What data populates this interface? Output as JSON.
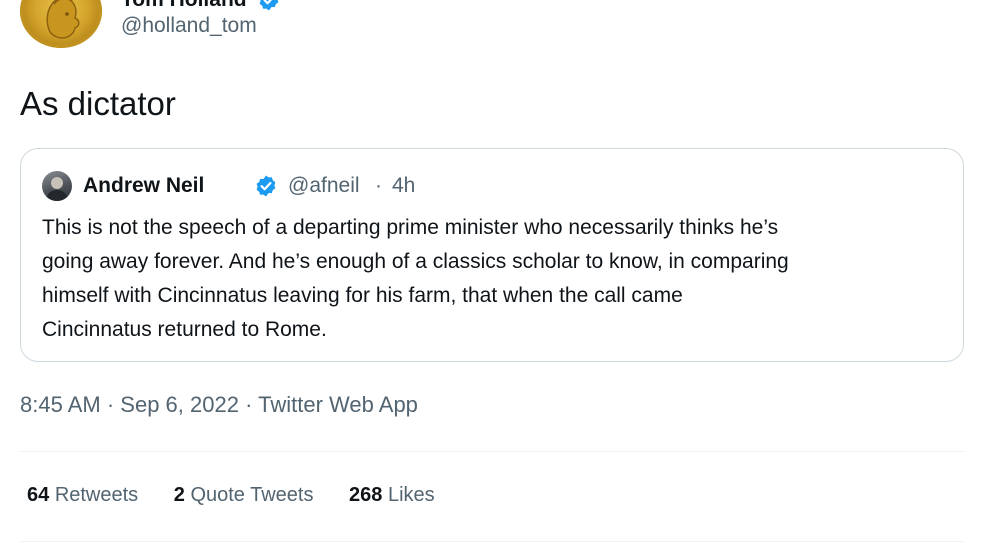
{
  "tweet": {
    "author_name": "Tom Holland",
    "author_handle": "@holland_tom",
    "text": "As dictator",
    "timestamp": "8:45 AM",
    "date": "Sep 6, 2022",
    "source": "Twitter Web App"
  },
  "quoted": {
    "author_name": "Andrew Neil",
    "author_handle": "@afneil",
    "separator": "·",
    "time_ago": "4h",
    "lines": [
      "This is not the speech of a departing prime minister who necessarily thinks he’s",
      "going away forever. And he’s enough of a classics scholar to know, in comparing",
      "himself with Cincinnatus leaving for his farm, that when the call came",
      "Cincinnatus returned to Rome."
    ]
  },
  "meta": {
    "separator": "·"
  },
  "stats": {
    "retweets_count": "64",
    "retweets_label": "Retweets",
    "quotes_count": "2",
    "quotes_label": "Quote Tweets",
    "likes_count": "268",
    "likes_label": "Likes"
  },
  "colors": {
    "verified": "#1d9bf0",
    "secondary_text": "#536471",
    "border": "#cfd9de"
  },
  "icons": {
    "author_avatar": "gold-coin-avatar",
    "verified": "verified-badge-icon",
    "quoted_avatar": "portrait-avatar"
  }
}
